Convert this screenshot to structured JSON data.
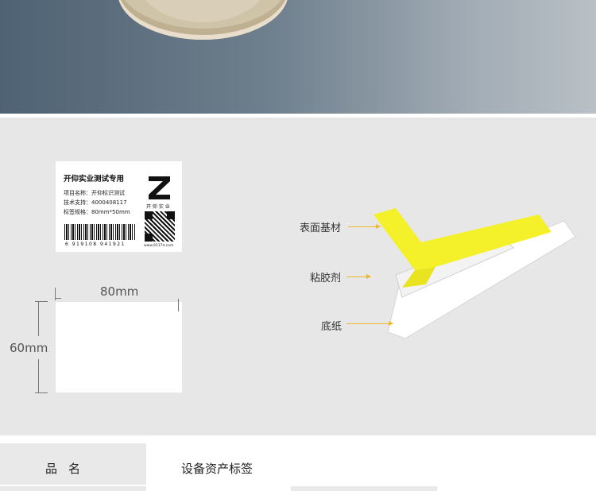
{
  "sample_label": {
    "title": "开仰实业测试专用",
    "line1": "项目名称：开仰标识测试",
    "line2": "技术支持：4000408117",
    "line3": "标签规格：80mm*50mm",
    "barcode_number": "6   919108   941921",
    "logo_text": "开 仰 实 业",
    "url": "www.9117d.com"
  },
  "dimensions": {
    "width": "80mm",
    "height": "60mm"
  },
  "layers": {
    "surface": "表面基材",
    "adhesive": "粘胶剂",
    "backing": "底纸"
  },
  "colors": {
    "face_stock": "#f4f02a",
    "arrow": "#f2b72c"
  },
  "spec": {
    "label": "品名",
    "value": "设备资产标签"
  }
}
